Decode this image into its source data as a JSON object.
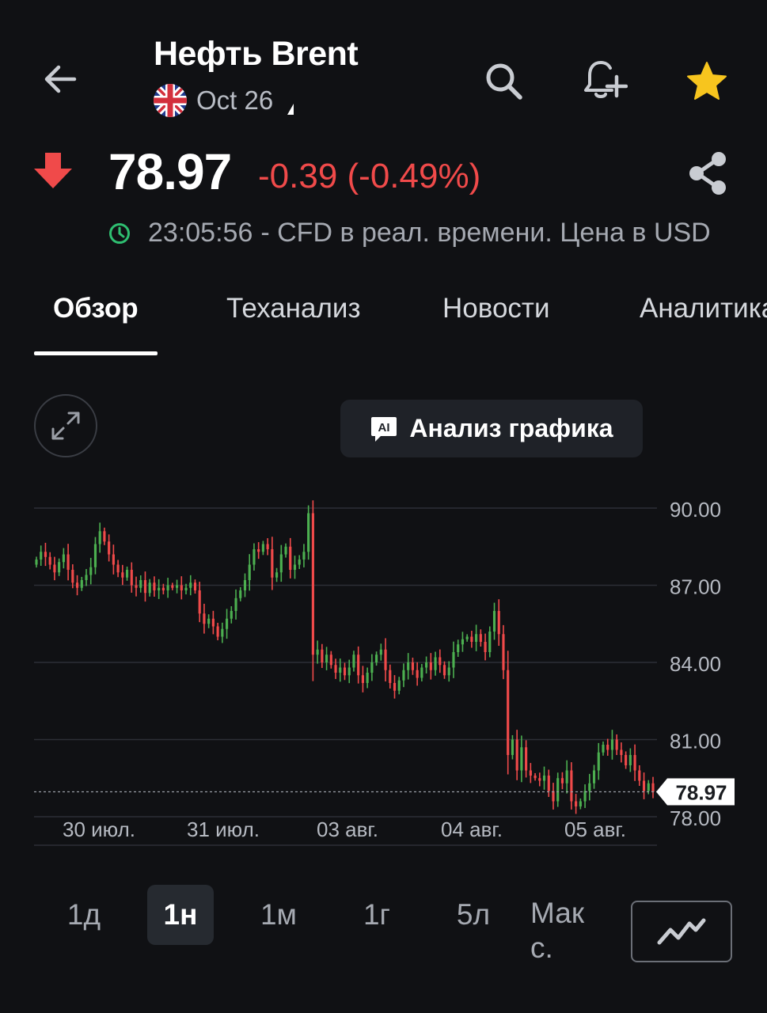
{
  "header": {
    "title": "Нефть Brent",
    "contract": "Oct 26",
    "icons": {
      "back": "arrow-left-icon",
      "search": "search-icon",
      "alert": "bell-plus-icon",
      "favorite": "star-icon",
      "flag": "uk-flag-icon"
    }
  },
  "quote": {
    "price": "78.97",
    "change": "-0.39 (-0.49%)",
    "direction": "down",
    "time": "23:05:56",
    "note": "- CFD в реал. времени. Цена в USD",
    "colors": {
      "down": "#f04a4a",
      "up": "#4caf50",
      "live": "#2fbf71"
    }
  },
  "tabs": [
    {
      "label": "Обзор",
      "active": true
    },
    {
      "label": "Теханализ",
      "active": false
    },
    {
      "label": "Новости",
      "active": false
    },
    {
      "label": "Аналитика",
      "active": false
    }
  ],
  "ai_button": {
    "badge": "AI",
    "label": "Анализ графика"
  },
  "chart_data": {
    "type": "candlestick",
    "ylim": [
      78,
      90
    ],
    "y_ticks": [
      "90.00",
      "87.00",
      "84.00",
      "81.00",
      "78.00"
    ],
    "x_ticks": [
      "30 июл.",
      "31 июл.",
      "03 авг.",
      "04 авг.",
      "05 авг."
    ],
    "last_price": "78.97",
    "last_value": 78.97,
    "up_color": "#4caf50",
    "down_color": "#f04a4a",
    "close": [
      88.0,
      88.3,
      88.1,
      87.8,
      87.5,
      87.9,
      88.2,
      87.6,
      87.1,
      86.9,
      87.2,
      87.4,
      87.7,
      88.6,
      89.1,
      88.7,
      88.2,
      87.8,
      87.5,
      87.3,
      87.6,
      87.0,
      86.9,
      87.2,
      86.7,
      87.1,
      86.8,
      86.9,
      86.8,
      87.0,
      86.9,
      87.0,
      86.8,
      86.9,
      87.1,
      86.8,
      85.9,
      85.5,
      85.7,
      85.4,
      85.0,
      85.3,
      85.7,
      86.0,
      86.5,
      86.8,
      87.2,
      87.8,
      88.4,
      88.3,
      88.6,
      88.4,
      87.3,
      87.5,
      88.2,
      88.5,
      87.6,
      87.8,
      88.0,
      88.3,
      89.8,
      84.3,
      84.5,
      84.0,
      84.3,
      83.9,
      83.6,
      83.8,
      83.5,
      83.8,
      84.3,
      83.5,
      83.2,
      83.6,
      84.0,
      84.3,
      84.5,
      83.7,
      83.2,
      82.9,
      83.3,
      83.7,
      84.0,
      83.7,
      83.4,
      83.8,
      84.0,
      83.7,
      84.2,
      83.9,
      83.5,
      83.8,
      84.4,
      84.7,
      84.9,
      85.0,
      84.8,
      85.1,
      84.8,
      84.4,
      85.2,
      86.0,
      85.1,
      83.7,
      80.4,
      81.0,
      79.8,
      80.7,
      79.8,
      79.6,
      79.5,
      79.4,
      79.6,
      79.0,
      78.6,
      79.5,
      79.3,
      79.8,
      78.6,
      78.4,
      78.6,
      79.0,
      79.3,
      79.8,
      80.5,
      80.8,
      80.6,
      81.0,
      80.6,
      80.4,
      80.0,
      80.4,
      79.8,
      79.4,
      79.0,
      79.3,
      78.97
    ]
  },
  "periods": [
    {
      "label": "1д",
      "active": false
    },
    {
      "label": "1н",
      "active": true
    },
    {
      "label": "1м",
      "active": false
    },
    {
      "label": "1г",
      "active": false
    },
    {
      "label": "5л",
      "active": false
    },
    {
      "label": "Макс.",
      "active": false
    }
  ],
  "chart_type_icon": "line-chart-icon"
}
